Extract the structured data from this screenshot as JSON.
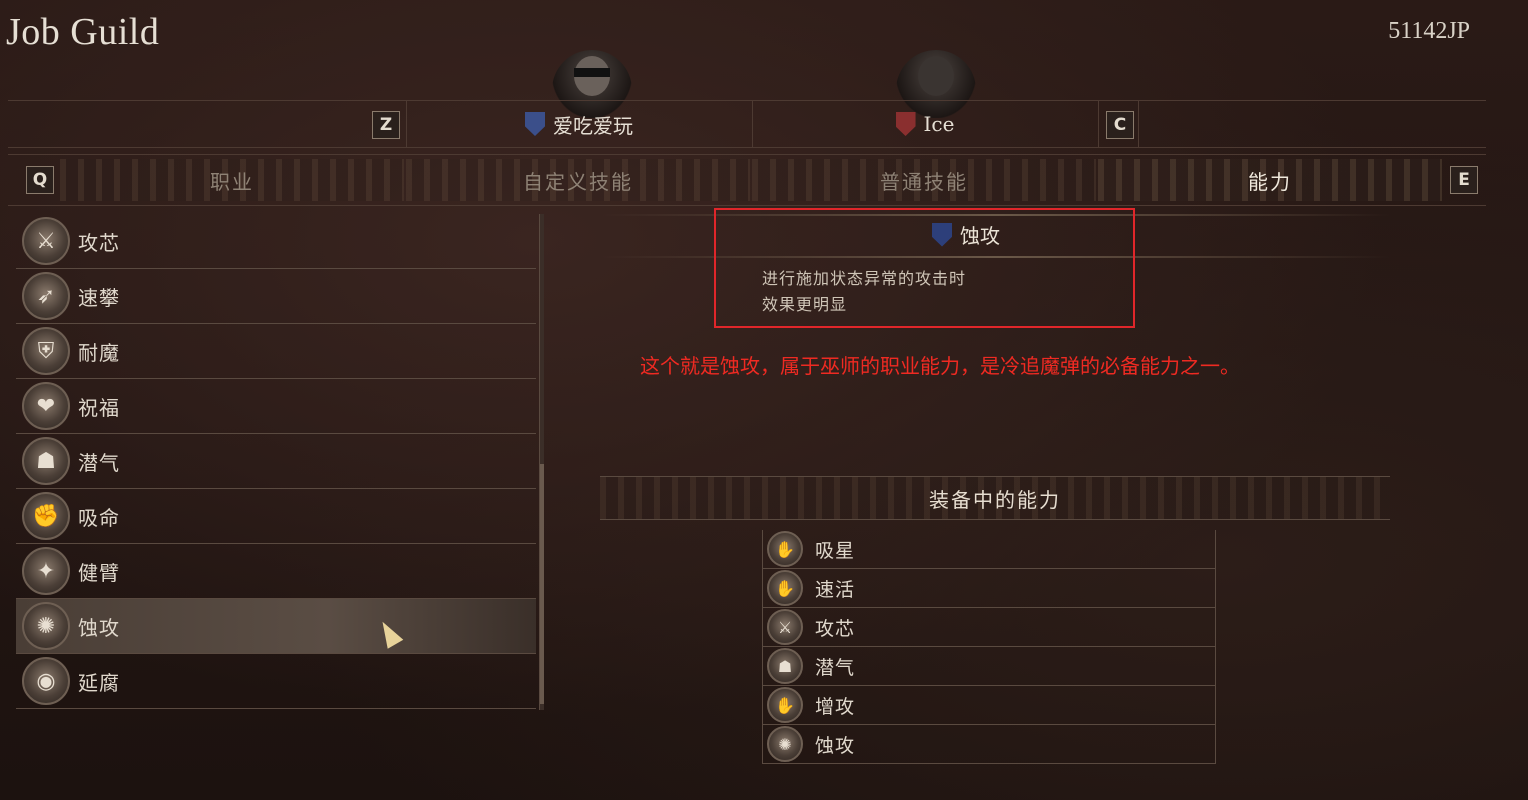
{
  "header": {
    "title": "Job Guild",
    "currency": "51142JP"
  },
  "characters": {
    "prev_key": "Z",
    "next_key": "C",
    "tabs": [
      {
        "name": "爱吃爱玩",
        "emblem_color": "#3b4f8a"
      },
      {
        "name": "Ice",
        "emblem_color": "#8a2f2f"
      }
    ]
  },
  "tabs": {
    "prev_key": "Q",
    "next_key": "E",
    "items": [
      "职业",
      "自定义技能",
      "普通技能",
      "能力"
    ],
    "active_index": 3
  },
  "ability_list": [
    {
      "label": "攻芯",
      "icon": "crossed-swords-icon",
      "glyph": "⚔"
    },
    {
      "label": "速攀",
      "icon": "running-figure-icon",
      "glyph": "➶"
    },
    {
      "label": "耐魔",
      "icon": "shield-icon",
      "glyph": "⛨"
    },
    {
      "label": "祝福",
      "icon": "broken-heart-icon",
      "glyph": "❤"
    },
    {
      "label": "潜气",
      "icon": "bust-icon",
      "glyph": "☗"
    },
    {
      "label": "吸命",
      "icon": "raised-arm-icon",
      "glyph": "✊"
    },
    {
      "label": "健臂",
      "icon": "flexing-arms-icon",
      "glyph": "✦"
    },
    {
      "label": "蚀攻",
      "icon": "swirl-icon",
      "glyph": "✺"
    },
    {
      "label": "延腐",
      "icon": "eye-icon",
      "glyph": "◉"
    }
  ],
  "selected_ability_index": 7,
  "detail": {
    "name": "蚀攻",
    "emblem_color": "#2d3f7a",
    "description_line1": "进行施加状态异常的攻击时",
    "description_line2": "效果更明显"
  },
  "annotation": "这个就是蚀攻，属于巫师的职业能力，是冷追魔弹的必备能力之一。",
  "equipped": {
    "header": "装备中的能力",
    "items": [
      {
        "label": "吸星",
        "icon": "palm-icon",
        "glyph": "✋"
      },
      {
        "label": "速活",
        "icon": "palm-icon",
        "glyph": "✋"
      },
      {
        "label": "攻芯",
        "icon": "crossed-swords-icon",
        "glyph": "⚔"
      },
      {
        "label": "潜气",
        "icon": "bust-icon",
        "glyph": "☗"
      },
      {
        "label": "增攻",
        "icon": "palm-icon",
        "glyph": "✋"
      },
      {
        "label": "蚀攻",
        "icon": "swirl-icon",
        "glyph": "✺"
      }
    ]
  },
  "colors": {
    "accent_red": "#e0262a",
    "text_primary": "#e6dfd4"
  }
}
